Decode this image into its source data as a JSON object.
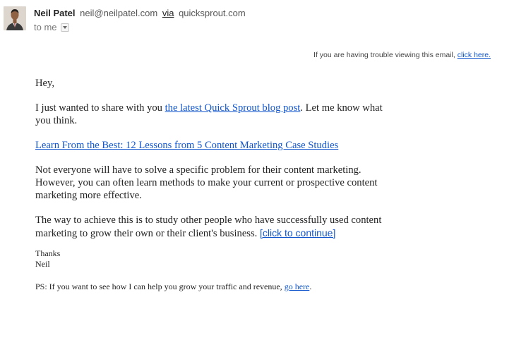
{
  "header": {
    "sender_name": "Neil Patel",
    "sender_email": "neil@neilpatel.com",
    "via_label": "via",
    "via_domain": "quicksprout.com",
    "to_label": "to me"
  },
  "trouble": {
    "text": "If you are having trouble viewing this email, ",
    "link": "click here."
  },
  "body": {
    "greeting": "Hey,",
    "p1_before": "I just wanted to share with you ",
    "p1_link": "the latest Quick Sprout blog post",
    "p1_after": ". Let me know what you think.",
    "post_title_link": "Learn From the Best: 12 Lessons from 5 Content Marketing Case Studies",
    "p2": "Not everyone will have to solve a specific problem for their content marketing. However, you can often learn methods to make your current or prospective content marketing more effective.",
    "p3_before": "The way to achieve this is to study other people who have successfully used content marketing to grow their own or their client's business. ",
    "p3_link": "[click to continue]",
    "thanks": "Thanks",
    "signature": "Neil",
    "ps_before": "PS: If you want to see how I can help you grow your traffic and revenue, ",
    "ps_link": "go here",
    "ps_after": "."
  }
}
